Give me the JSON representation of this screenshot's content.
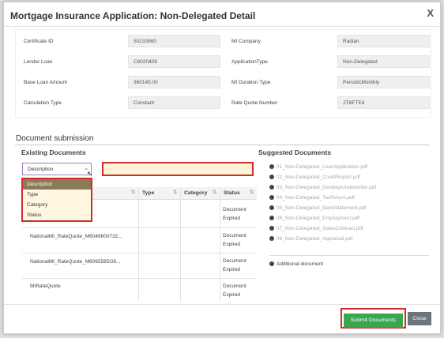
{
  "modal": {
    "title": "Mortgage Insurance Application: Non-Delegated Detail",
    "close_glyph": "X"
  },
  "details": [
    {
      "label": "Certificate ID",
      "value": "50233960"
    },
    {
      "label": "MI Company",
      "value": "Radian"
    },
    {
      "label": "Lender Loan",
      "value": "C6020409"
    },
    {
      "label": "ApplicationType",
      "value": "Non-Delegated"
    },
    {
      "label": "Base Loan Amount",
      "value": "360145.00"
    },
    {
      "label": "MI Duration Type",
      "value": "PeriodicMonthly"
    },
    {
      "label": "Calculation Type",
      "value": "Constant"
    },
    {
      "label": "Rate Quote Number",
      "value": "JTBFTE6"
    }
  ],
  "document_submission": {
    "title": "Document submission",
    "existing_title": "Existing Documents",
    "suggested_title": "Suggested Documents"
  },
  "filter": {
    "selected": "Description",
    "search_value": "",
    "options": [
      "Description",
      "Type",
      "Category",
      "Status"
    ]
  },
  "table": {
    "columns": [
      "",
      "Type",
      "Category",
      "Status"
    ],
    "rows": [
      {
        "description": "",
        "type": "",
        "category": "",
        "status_1": "Document",
        "status_2": "Expired"
      },
      {
        "description": "NationalMI_RateQuote_M6049600732...",
        "type": "",
        "category": "",
        "status_1": "Document",
        "status_2": "Expired"
      },
      {
        "description": "NationalMI_RateQuote_M6065585O9...",
        "type": "",
        "category": "",
        "status_1": "Document",
        "status_2": "Expired"
      },
      {
        "description": "MIRateQuote",
        "type": "",
        "category": "",
        "status_1": "Document",
        "status_2": "Expired"
      }
    ]
  },
  "suggested": [
    "01_Non-Delegated_LoanApplication.pdf",
    "02_Non-Delegated_CreditReport.pdf",
    "03_Non-Delegated_DesktopUnderwriter.pdf",
    "04_Non-Delegated_TaxReturn.pdf",
    "05_Non-Delegated_BankStatement.pdf",
    "06_Non-Delegated_Employment.pdf",
    "07_Non-Delegated_SalesContract.pdf",
    "08_Non-Delegated_Appraisal.pdf"
  ],
  "additional_document": "Additional document",
  "buttons": {
    "submit": "Submit Documents",
    "close": "Close"
  },
  "colors": {
    "highlight": "#d12b2b",
    "submit_green": "#3aa650",
    "close_gray": "#6d747a",
    "dropdown_active": "#8b7a57"
  }
}
